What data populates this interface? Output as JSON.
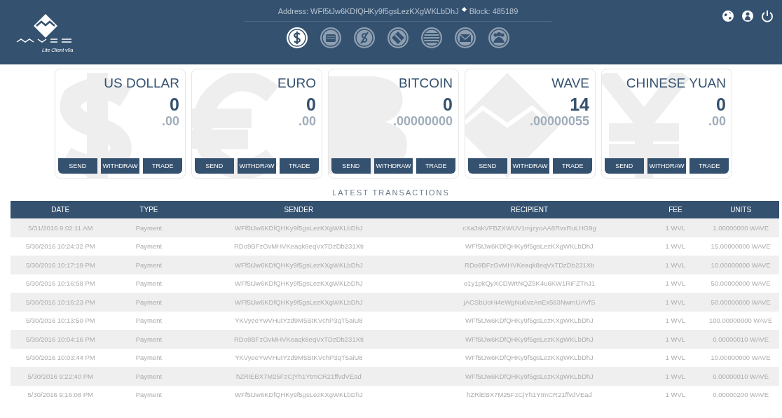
{
  "header": {
    "logo_caption": "Lite Client v0a",
    "address_label": "Address:",
    "address": "WFf5tJw6KDfQHKy9f5gsLezKXgWKLbDhJ",
    "block_label": "Block:",
    "block": "485189"
  },
  "nav": [
    {
      "kind": "dollar",
      "selected": true
    },
    {
      "kind": "wallet",
      "selected": false
    },
    {
      "kind": "no-money",
      "selected": false
    },
    {
      "kind": "diamond",
      "selected": false
    },
    {
      "kind": "stripes",
      "selected": false
    },
    {
      "kind": "mail",
      "selected": false
    },
    {
      "kind": "people",
      "selected": false
    }
  ],
  "top_icons": [
    {
      "kind": "globe"
    },
    {
      "kind": "user"
    },
    {
      "kind": "power"
    }
  ],
  "wallets": [
    {
      "kind": "dollar",
      "name": "US DOLLAR",
      "integer": "0",
      "fraction": ".00",
      "buttons": [
        "SEND",
        "WITHDRAW",
        "TRADE"
      ]
    },
    {
      "kind": "euro",
      "name": "EURO",
      "integer": "0",
      "fraction": ".00",
      "buttons": [
        "SEND",
        "WITHDRAW",
        "TRADE"
      ]
    },
    {
      "kind": "bitcoin",
      "name": "BITCOIN",
      "integer": "0",
      "fraction": ".00000000",
      "buttons": [
        "SEND",
        "WITHDRAW",
        "TRADE"
      ]
    },
    {
      "kind": "wave",
      "name": "WAVE",
      "integer": "14",
      "fraction": ".00000055",
      "buttons": [
        "SEND",
        "WITHDRAW",
        "TRADE"
      ]
    },
    {
      "kind": "yuan",
      "name": "CHINESE YUAN",
      "integer": "0",
      "fraction": ".00",
      "buttons": [
        "SEND",
        "WITHDRAW",
        "TRADE"
      ]
    }
  ],
  "transactions": {
    "title": "LATEST TRANSACTIONS",
    "columns": [
      "DATE",
      "TYPE",
      "SENDER",
      "RECIPIENT",
      "FEE",
      "UNITS"
    ],
    "rows": [
      [
        "5/31/2016 9:02:11 AM",
        "Payment",
        "WFf5tJw6KDfQHKy9f5gsLezKXgWKLbDhJ",
        "cXa3skVFBZXWUV1mjzyoAA8RvxRuLHG9g",
        "1 WVL",
        "1.00000000 WAVE"
      ],
      [
        "5/30/2016 10:24:32 PM",
        "Payment",
        "RDo9BFzGvMHVKeaqk8eqVxTDzDb231Xti",
        "WFf5tJw6KDfQHKy9f5gsLezKXgWKLbDhJ",
        "1 WVL",
        "15.00000000 WAVE"
      ],
      [
        "5/30/2016 10:17:19 PM",
        "Payment",
        "WFf5tJw6KDfQHKy9f5gsLezKXgWKLbDhJ",
        "RDo9BFzGvMHVKeaqk8eqVxTDzDb231Xti",
        "1 WVL",
        "10.00000000 WAVE"
      ],
      [
        "5/30/2016 10:16:58 PM",
        "Payment",
        "WFf5tJw6KDfQHKy9f5gsLezKXgWKLbDhJ",
        "o1y1pkQyXCDWrtNQZ9K4u6KW1RiFZTnJ1",
        "1 WVL",
        "50.00000000 WAVE"
      ],
      [
        "5/30/2016 10:16:23 PM",
        "Payment",
        "WFf5tJw6KDfQHKy9f5gsLezKXgWKLbDhJ",
        "jACSbUoHi4eWgNu6vzAnEx583NwmUAVfS",
        "1 WVL",
        "50.00000000 WAVE"
      ],
      [
        "5/30/2016 10:13:50 PM",
        "Payment",
        "YKVyeeYwVHutYzd9M5BtKVchP3qT5aiU8",
        "WFf5tJw6KDfQHKy9f5gsLezKXgWKLbDhJ",
        "1 WVL",
        "100.00000000 WAVE"
      ],
      [
        "5/30/2016 10:04:16 PM",
        "Payment",
        "RDo9BFzGvMHVKeaqk8eqVxTDzDb231Xti",
        "WFf5tJw6KDfQHKy9f5gsLezKXgWKLbDhJ",
        "1 WVL",
        "0.00000010 WAVE"
      ],
      [
        "5/30/2016 10:03:44 PM",
        "Payment",
        "YKVyeeYwVHutYzd9M5BtKVchP3qT5aiU8",
        "WFf5tJw6KDfQHKy9f5gsLezKXgWKLbDhJ",
        "1 WVL",
        "10.00000000 WAVE"
      ],
      [
        "5/30/2016 9:22:40 PM",
        "Payment",
        "hZRiEBX7M25FzCjYh1YtmCR21ffvdVEad",
        "WFf5tJw6KDfQHKy9f5gsLezKXgWKLbDhJ",
        "1 WVL",
        "0.00000010 WAVE"
      ],
      [
        "5/30/2016 9:16:08 PM",
        "Payment",
        "WFf5tJw6KDfQHKy9f5gsLezKXgWKLbDhJ",
        "hZRiEBX7M25FzCjYh1YtmCR21ffvdVEad",
        "1 WVL",
        "0.00000200 WAVE"
      ]
    ]
  }
}
